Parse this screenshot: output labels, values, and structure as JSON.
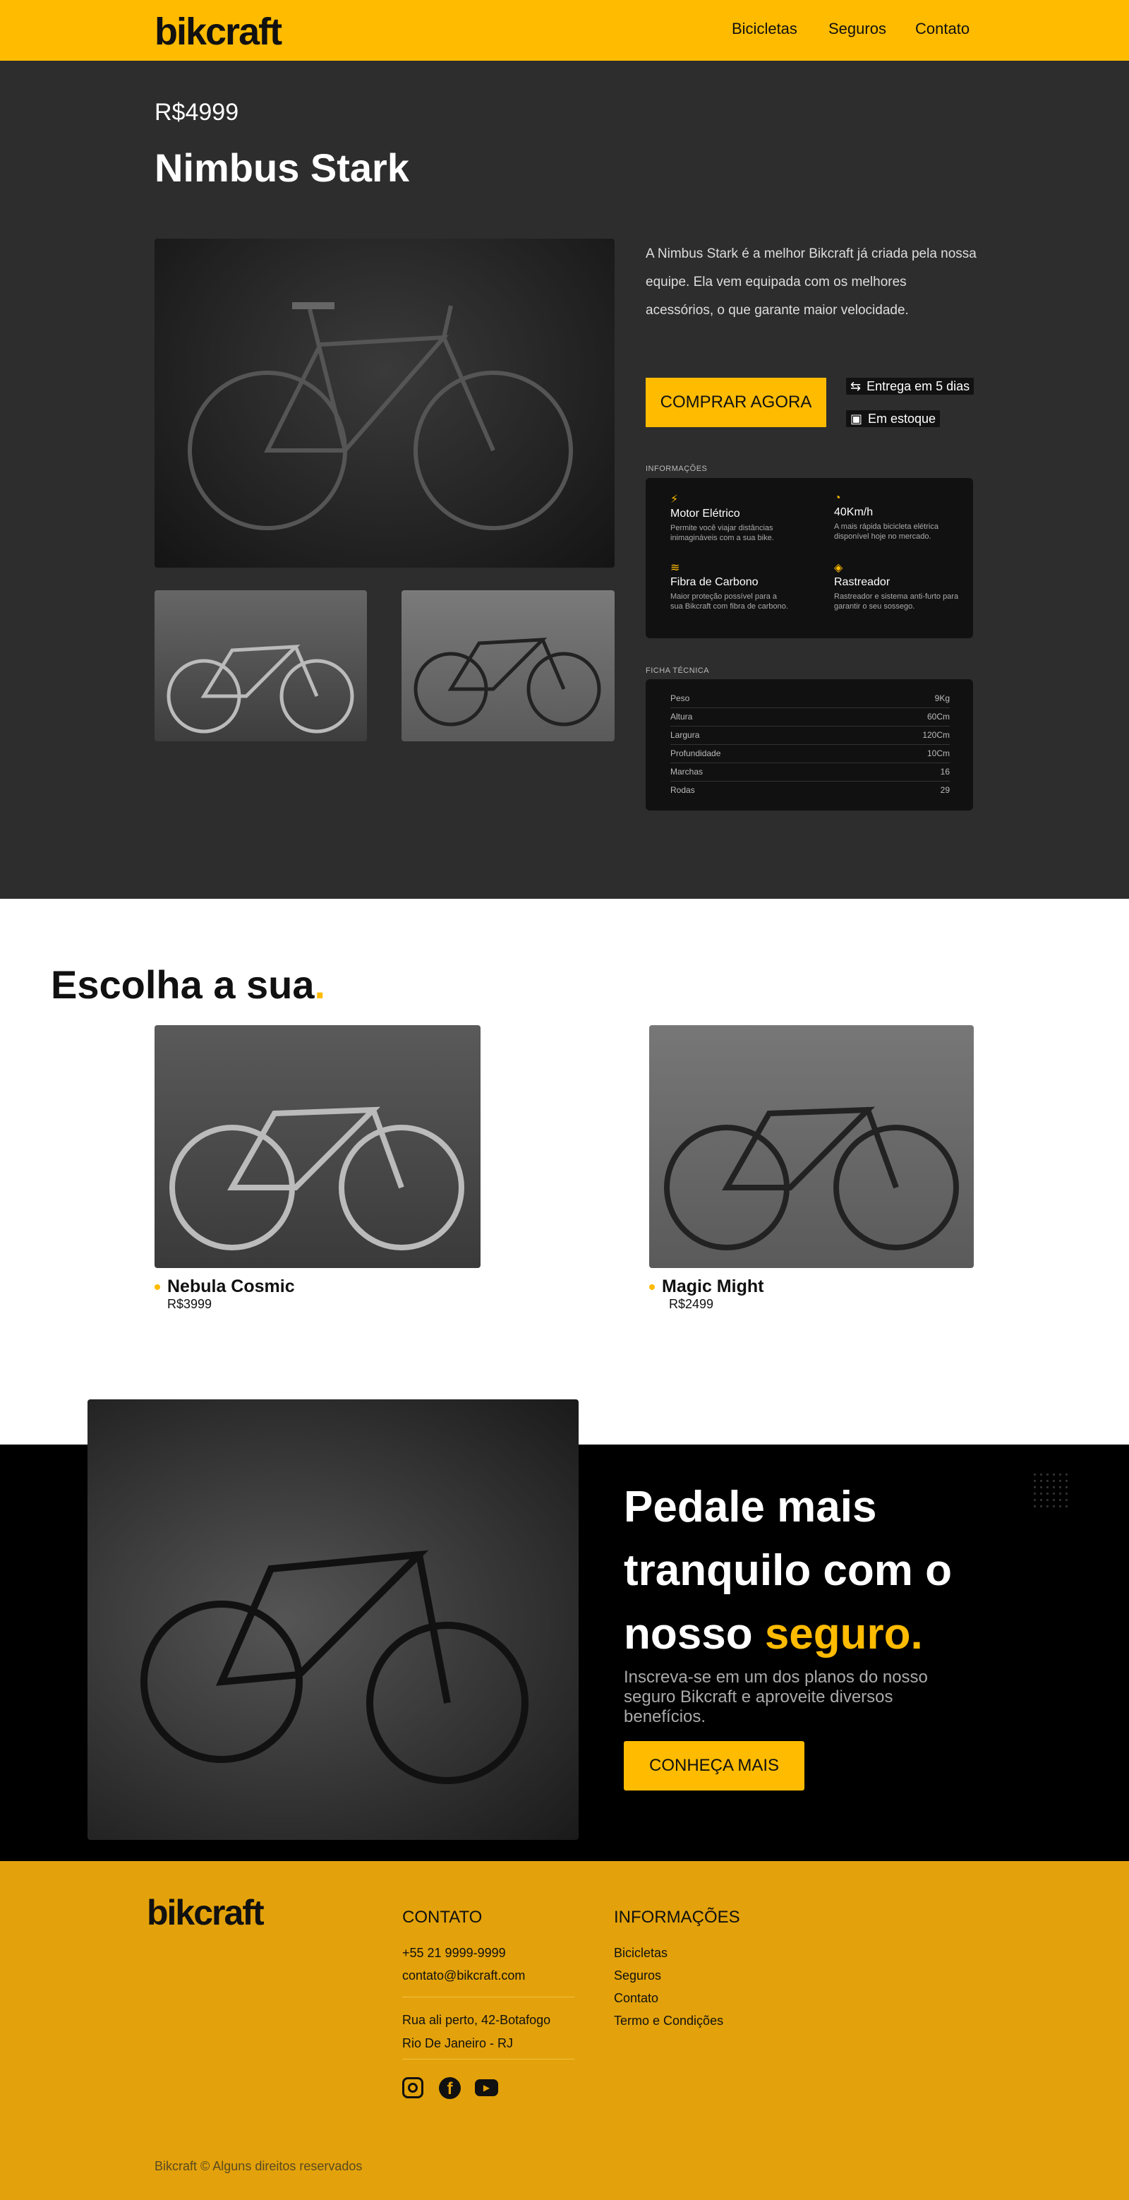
{
  "header": {
    "logo": "bikcraft",
    "nav": [
      "Bicicletas",
      "Seguros",
      "Contato"
    ]
  },
  "product": {
    "price": "R$4999",
    "name": "Nimbus Stark",
    "description": "A Nimbus Stark é a melhor Bikcraft já criada pela nossa equipe. Ela vem equipada com os melhores acessórios, o que garante maior velocidade.",
    "buy_label": "COMPRAR AGORA",
    "delivery": "Entrega em 5 dias",
    "stock": "Em estoque",
    "info_label": "INFORMAÇÕES",
    "features": [
      {
        "icon": "bolt-icon",
        "title": "Motor Elétrico",
        "desc": "Permite você viajar distâncias inimagináveis com a sua bike."
      },
      {
        "icon": "speedometer-icon",
        "title": "40Km/h",
        "desc": "A mais rápida bicicleta elétrica disponível hoje no mercado."
      },
      {
        "icon": "layers-icon",
        "title": "Fibra de Carbono",
        "desc": "Maior proteção possível para a sua Bikcraft com fibra de carbono."
      },
      {
        "icon": "tracker-icon",
        "title": "Rastreador",
        "desc": "Rastreador e sistema anti-furto para garantir o seu sossego."
      }
    ],
    "spec_label": "FICHA TÉCNICA",
    "specs": [
      {
        "k": "Peso",
        "v": "9Kg"
      },
      {
        "k": "Altura",
        "v": "60Cm"
      },
      {
        "k": "Largura",
        "v": "120Cm"
      },
      {
        "k": "Profundidade",
        "v": "10Cm"
      },
      {
        "k": "Marchas",
        "v": "16"
      },
      {
        "k": "Rodas",
        "v": "29"
      }
    ]
  },
  "choose": {
    "title": "Escolha a sua",
    "title_dot": ".",
    "items": [
      {
        "name": "Nebula Cosmic",
        "price": "R$3999"
      },
      {
        "name": "Magic Might",
        "price": "R$2499"
      }
    ]
  },
  "insurance": {
    "title_1": "Pedale mais tranquilo com o nosso",
    "title_hl": "seguro.",
    "subtitle": "Inscreva-se em um dos planos do nosso seguro Bikcraft e aproveite diversos benefícios.",
    "button": "CONHEÇA MAIS"
  },
  "footer": {
    "logo": "bikcraft",
    "contact_title": "CONTATO",
    "phone": "+55 21 9999-9999",
    "email": "contato@bikcraft.com",
    "address_1": "Rua ali perto, 42-Botafogo",
    "address_2": "Rio De Janeiro - RJ",
    "info_title": "INFORMAÇÕES",
    "links": [
      "Bicicletas",
      "Seguros",
      "Contato",
      "Termo e Condições"
    ],
    "copyright": "Bikcraft © Alguns direitos reservados"
  },
  "colors": {
    "accent": "#FFBB00",
    "dark": "#2D2D2E",
    "footer": "#E3A20B"
  }
}
